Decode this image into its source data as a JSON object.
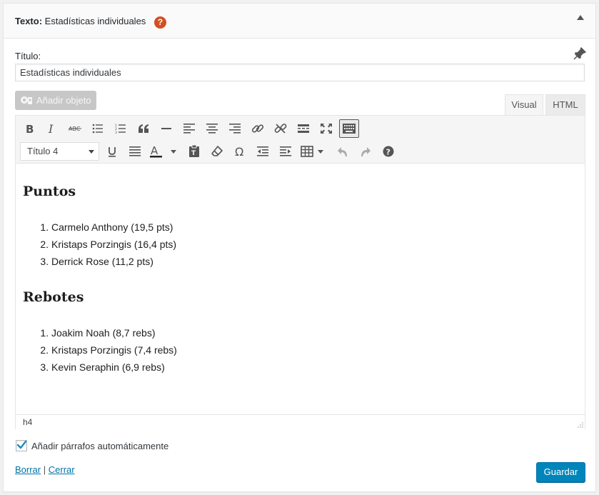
{
  "widget": {
    "title_prefix": "Texto:",
    "title_name": "Estadísticas individuales",
    "help_symbol": "?"
  },
  "form": {
    "title_label": "Título:",
    "title_value": "Estadísticas individuales",
    "add_media_label": "Añadir objeto"
  },
  "tabs": [
    {
      "label": "Visual",
      "active": true
    },
    {
      "label": "HTML",
      "active": false
    }
  ],
  "toolbar": {
    "format_select": "Título 4",
    "row1_icons": [
      "bold-icon",
      "italic-icon",
      "strikethrough-icon",
      "bullet-list-icon",
      "numbered-list-icon",
      "blockquote-icon",
      "horizontal-rule-icon",
      "align-left-icon",
      "align-center-icon",
      "align-right-icon",
      "link-icon",
      "unlink-icon",
      "read-more-icon",
      "fullscreen-icon",
      "toolbar-toggle-icon"
    ],
    "row2_icons": [
      "underline-icon",
      "justify-icon",
      "text-color-icon",
      "paste-text-icon",
      "clear-formatting-icon",
      "special-character-icon",
      "outdent-icon",
      "indent-icon",
      "table-icon",
      "undo-icon",
      "redo-icon",
      "help-icon"
    ]
  },
  "content": {
    "sections": [
      {
        "heading": "Puntos",
        "items": [
          "Carmelo Anthony (19,5 pts)",
          "Kristaps Porzingis (16,4 pts)",
          "Derrick Rose (11,2 pts)"
        ]
      },
      {
        "heading": "Rebotes",
        "items": [
          "Joakim Noah (8,7 rebs)",
          "Kristaps Porzingis (7,4 rebs)",
          "Kevin Seraphin (6,9 rebs)"
        ]
      }
    ]
  },
  "statusbar": {
    "path": "h4"
  },
  "options": {
    "auto_paragraphs_label": "Añadir párrafos automáticamente",
    "auto_paragraphs_checked": true
  },
  "actions": {
    "delete_label": "Borrar",
    "separator": "|",
    "close_label": "Cerrar",
    "save_label": "Guardar"
  },
  "colors": {
    "primary": "#0085ba",
    "help": "#d54e21",
    "link": "#0073aa"
  }
}
